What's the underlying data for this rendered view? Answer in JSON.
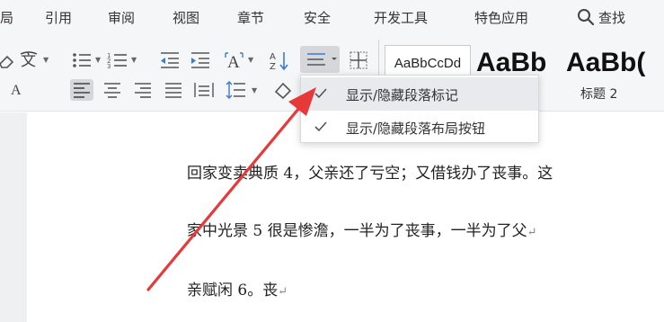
{
  "menubar": {
    "items": [
      "局",
      "引用",
      "审阅",
      "视图",
      "章节",
      "安全",
      "开发工具",
      "特色应用"
    ],
    "search_label": "查找",
    "search_icon": "search-icon"
  },
  "toolbar": {
    "case_label": "A",
    "font_a_label": "A",
    "icons": {
      "eraser": "eraser-icon",
      "phonetic": "phonetic-guide-icon",
      "bullets": "bullet-list-icon",
      "numbering": "numbered-list-icon",
      "decrease_indent": "decrease-indent-icon",
      "increase_indent": "increase-indent-icon",
      "change_case": "change-case-icon",
      "sort": "sort-az-icon",
      "show_marks": "paragraph-mark-icon",
      "borders": "table-borders-icon",
      "align_left": "align-left-icon",
      "align_center": "align-center-icon",
      "align_right": "align-right-icon",
      "justify": "justify-icon",
      "distributed": "distributed-icon",
      "line_spacing": "line-spacing-icon",
      "shading": "shading-icon"
    }
  },
  "styles": {
    "normal_sample": "AaBbCcDd",
    "heading1_sample": "AaBb",
    "heading2_sample": "AaBb(",
    "heading2_caption": "标题 2"
  },
  "dropdown": {
    "items": [
      {
        "label": "显示/隐藏段落标记",
        "checked": true
      },
      {
        "label": "显示/隐藏段落布局按钮",
        "checked": true
      }
    ]
  },
  "document": {
    "lines": [
      "回家变卖典质 4，父亲还了亏空；又借钱办了丧事。这",
      "家中光景 5 很是惨澹，一半为了丧事，一半为了父",
      "亲赋闲 6。丧"
    ],
    "para_mark": "↵"
  },
  "colors": {
    "arrow": "#e8393a",
    "menubar_bg": "#f5f6f7",
    "highlight": "#e8eaed"
  }
}
